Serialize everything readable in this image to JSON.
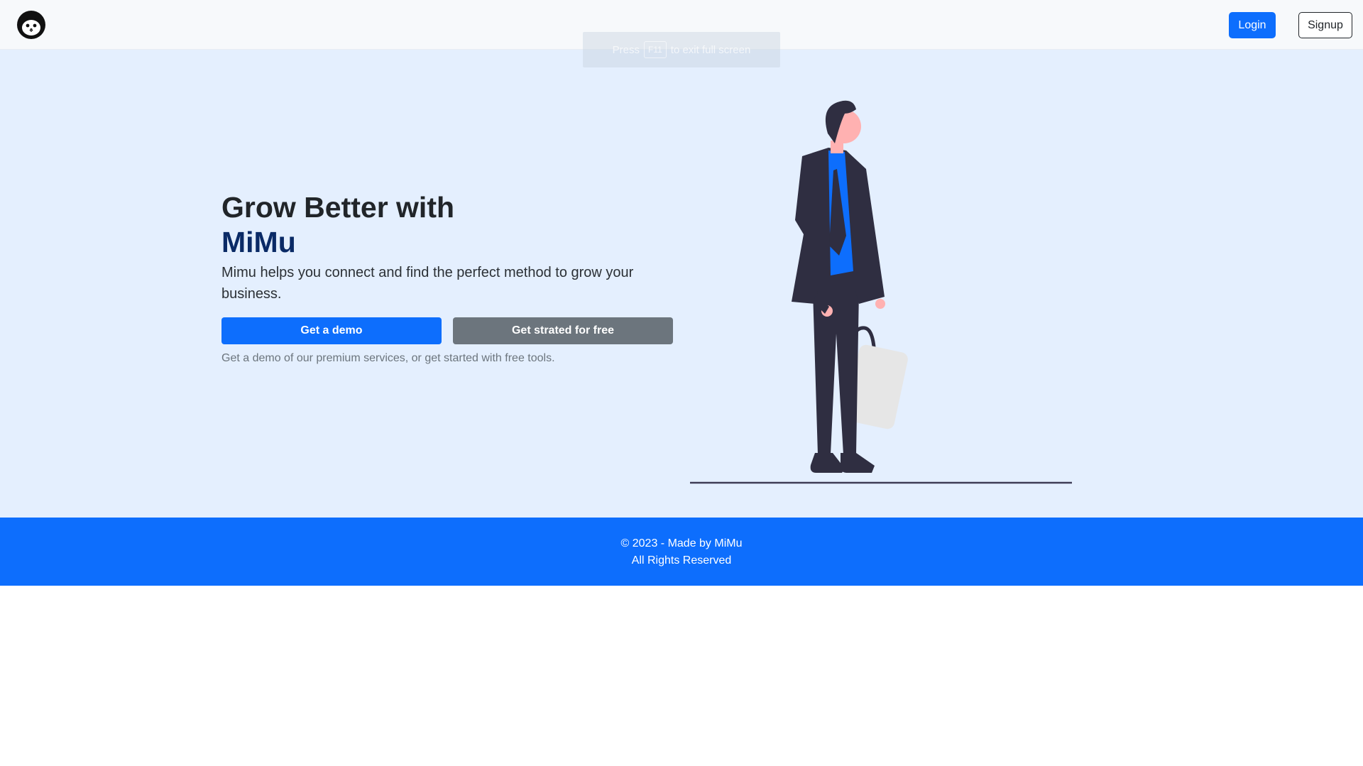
{
  "nav": {
    "logo_icon": "cat-face-icon",
    "login_label": "Login",
    "signup_label": "Signup"
  },
  "fullscreen_toast": {
    "prefix": "Press",
    "key": "F11",
    "suffix": "to exit full screen"
  },
  "hero": {
    "title_line1": "Grow Better with",
    "title_brand": "MiMu",
    "subtitle": "Mimu helps you connect and find the perfect method to grow your business.",
    "demo_button": "Get a demo",
    "free_button": "Get strated for free",
    "note": "Get a demo of our premium services, or get started with free tools.",
    "illustration_icon": "businessman-illustration"
  },
  "footer": {
    "line1": "© 2023 - Made by MiMu",
    "line2": "All Rights Reserved"
  },
  "colors": {
    "primary": "#0d6efd",
    "secondary": "#6c757d",
    "hero_bg": "#e4effe",
    "brand_text": "#0a2a66",
    "navbar_bg": "#f7f9fb"
  }
}
